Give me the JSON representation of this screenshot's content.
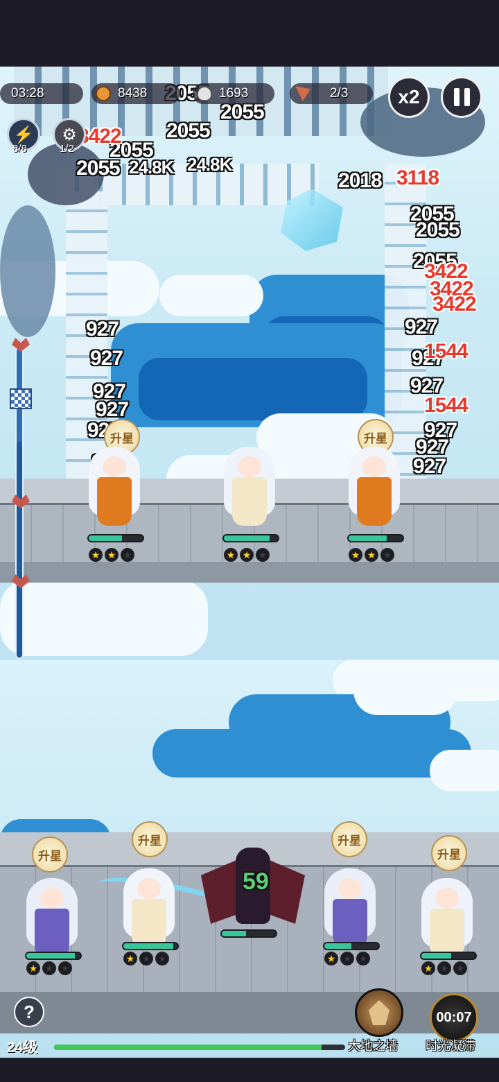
{
  "hud": {
    "timer": "03:28",
    "coins": "8438",
    "kills": "1693",
    "wave": "2/3",
    "speed": "x2",
    "pause_icon": "pause-icon",
    "skill_1_count": "8/8",
    "skill_2_count": "1/2"
  },
  "damage_numbers": {
    "white": [
      "2055",
      "2055",
      "2055",
      "2055",
      "2055",
      "2055",
      "2055",
      "2055",
      "2018",
      "927",
      "927",
      "927",
      "927",
      "927",
      "927",
      "927",
      "927",
      "927",
      "927",
      "927",
      "927"
    ],
    "red": [
      "3422",
      "3118",
      "3422",
      "3422",
      "3422",
      "1544",
      "1544"
    ],
    "other": [
      "24.8K",
      "24.8K"
    ]
  },
  "upgrade_label": "升星",
  "top_heroes": [
    {
      "name": "fox-staff-girl",
      "stars": 2,
      "hp": 0.62,
      "colors": {
        "hair": "#f1f4fb",
        "dress": "#e07a1e"
      }
    },
    {
      "name": "white-priestess",
      "stars": 2,
      "hp": 0.85,
      "colors": {
        "hair": "#eef3fb",
        "dress": "#f3e7c8"
      }
    },
    {
      "name": "fox-staff-girl-2",
      "stars": 2,
      "hp": 0.7,
      "colors": {
        "hair": "#f1f4fb",
        "dress": "#e07a1e"
      }
    }
  ],
  "bottom_heroes": [
    {
      "name": "ice-mage",
      "stars": 1,
      "hp": 0.9,
      "colors": {
        "hair": "#e9eef8",
        "dress": "#6c5fbf"
      }
    },
    {
      "name": "sword-dancer",
      "stars": 1,
      "hp": 0.92,
      "colors": {
        "hair": "#f1f4fb",
        "dress": "#f3e7c8"
      }
    },
    {
      "name": "demon-lord",
      "stars": 0,
      "hp": 0.45,
      "colors": {
        "hair": "#2a1a2e",
        "dress": "#5d1f2c"
      }
    },
    {
      "name": "ice-mage-2",
      "stars": 1,
      "hp": 0.5,
      "colors": {
        "hair": "#e9eef8",
        "dress": "#6c5fbf"
      }
    },
    {
      "name": "white-priestess-2",
      "stars": 1,
      "hp": 0.55,
      "colors": {
        "hair": "#eef3fb",
        "dress": "#f3e7c8"
      }
    }
  ],
  "demon_number": "59",
  "abilities": [
    {
      "label": "大地之墙",
      "icon": "earth-wall-icon"
    },
    {
      "label": "时光凝滞",
      "icon": "time-freeze-icon",
      "cooldown": "00:07"
    }
  ],
  "player": {
    "level": "24级",
    "xp": 0.92
  },
  "help_icon": "?"
}
